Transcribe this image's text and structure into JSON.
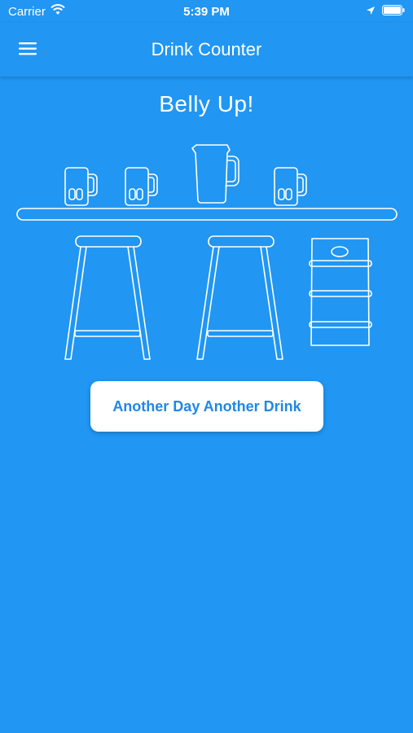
{
  "status_bar": {
    "carrier": "Carrier",
    "time": "5:39 PM",
    "icons": [
      "wifi-icon",
      "location-arrow-icon",
      "battery-icon"
    ]
  },
  "nav": {
    "title": "Drink Counter",
    "menu_icon": "hamburger-menu-icon"
  },
  "main": {
    "headline": "Belly Up!",
    "illustration_items": [
      "beer-mug-icon",
      "beer-mug-icon",
      "pitcher-icon",
      "beer-mug-icon",
      "bar-stool-icon",
      "bar-stool-icon",
      "keg-icon"
    ],
    "action_button_label": "Another Day Another Drink"
  },
  "colors": {
    "background": "#2196F3",
    "button_bg": "#FFFFFF",
    "button_text": "#1E88E5"
  }
}
